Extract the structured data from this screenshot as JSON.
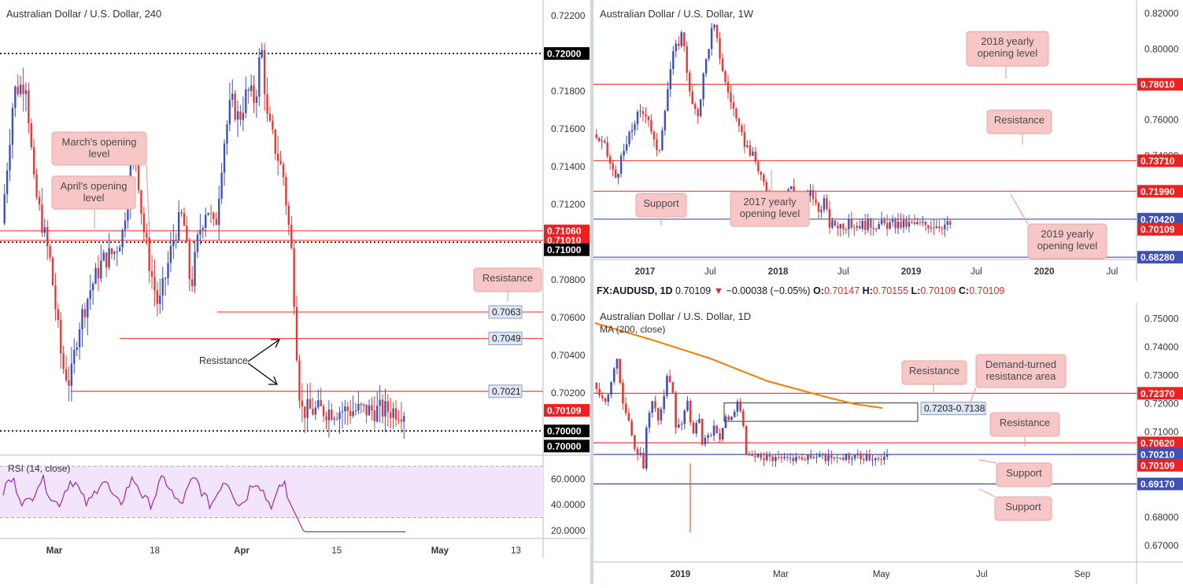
{
  "colors": {
    "up": "#3f51b5",
    "down": "#e53935",
    "hline": "#f04040",
    "blue": "#3f51b5",
    "callout_bg": "#f7c7c7",
    "callout_border": "#e7a5a5",
    "price_tag": "#ef2020",
    "ma": "#f57c00",
    "rsi": "#9c27b0"
  },
  "chart_data": [
    {
      "type": "candlestick",
      "title": "Australian Dollar / U.S. Dollar, 240",
      "ylim": [
        0.6988,
        0.7225
      ],
      "y_ticks": [
        "0.72200",
        "0.71800",
        "0.71600",
        "0.71400",
        "0.71200",
        "0.70800",
        "0.70600",
        "0.70400",
        "0.70200"
      ],
      "y_tick_values": [
        0.722,
        0.718,
        0.716,
        0.714,
        0.712,
        0.708,
        0.706,
        0.704,
        0.702
      ],
      "x_ticks": [
        "Mar",
        "18",
        "Apr",
        "15",
        "May",
        "13"
      ],
      "x_tick_pos": [
        0.1,
        0.285,
        0.445,
        0.62,
        0.81,
        0.95
      ],
      "price_tags": [
        {
          "text": "0.72000",
          "value": 0.72,
          "style": "black"
        },
        {
          "text": "0.71060",
          "value": 0.7106,
          "style": "red"
        },
        {
          "text": "0.71010",
          "value": 0.7101,
          "style": "red"
        },
        {
          "text": "0.71000",
          "value": 0.7096,
          "style": "black"
        },
        {
          "text": "0.70109",
          "value": 0.70109,
          "style": "red"
        },
        {
          "text": "0.70000",
          "value": 0.7,
          "style": "black"
        },
        {
          "text": "0.70000",
          "value": 0.6992,
          "style": "black"
        }
      ],
      "levels": [
        {
          "value": 0.72,
          "style": "dotted",
          "x0": 0.0
        },
        {
          "value": 0.7106,
          "style": "red",
          "x0": 0.0
        },
        {
          "value": 0.7101,
          "style": "red",
          "x0": 0.0
        },
        {
          "value": 0.71,
          "style": "dotted",
          "x0": 0.0
        },
        {
          "value": 0.7063,
          "style": "red",
          "x0": 0.4
        },
        {
          "value": 0.7049,
          "style": "red",
          "x0": 0.22
        },
        {
          "value": 0.7021,
          "style": "red",
          "x0": 0.13
        },
        {
          "value": 0.7,
          "style": "dotted",
          "x0": 0.0
        }
      ],
      "level_labels": [
        {
          "text": "0.7063",
          "value": 0.7063
        },
        {
          "text": "0.7049",
          "value": 0.7049
        },
        {
          "text": "0.7021",
          "value": 0.7021
        }
      ],
      "annotations": [
        "March's opening level",
        "April's opening level",
        "Resistance",
        "Resistance"
      ],
      "series_path": [
        [
          0,
          0.711
        ],
        [
          0.03,
          0.718
        ],
        [
          0.06,
          0.7185
        ],
        [
          0.08,
          0.713
        ],
        [
          0.1,
          0.711
        ],
        [
          0.12,
          0.709
        ],
        [
          0.15,
          0.7035
        ],
        [
          0.17,
          0.7025
        ],
        [
          0.19,
          0.7055
        ],
        [
          0.22,
          0.7075
        ],
        [
          0.25,
          0.709
        ],
        [
          0.28,
          0.7095
        ],
        [
          0.3,
          0.7105
        ],
        [
          0.33,
          0.7155
        ],
        [
          0.35,
          0.711
        ],
        [
          0.37,
          0.7085
        ],
        [
          0.39,
          0.7065
        ],
        [
          0.41,
          0.7085
        ],
        [
          0.43,
          0.7105
        ],
        [
          0.45,
          0.7115
        ],
        [
          0.47,
          0.7075
        ],
        [
          0.49,
          0.7105
        ],
        [
          0.51,
          0.712
        ],
        [
          0.53,
          0.7105
        ],
        [
          0.55,
          0.715
        ],
        [
          0.57,
          0.7175
        ],
        [
          0.59,
          0.7165
        ],
        [
          0.61,
          0.718
        ],
        [
          0.63,
          0.7175
        ],
        [
          0.645,
          0.7205
        ],
        [
          0.66,
          0.7165
        ],
        [
          0.68,
          0.715
        ],
        [
          0.7,
          0.7135
        ],
        [
          0.72,
          0.7095
        ],
        [
          0.73,
          0.706
        ],
        [
          0.735,
          0.7035
        ],
        [
          0.74,
          0.7021
        ],
        [
          0.745,
          0.70109
        ]
      ],
      "rsi": {
        "label": "RSI (14, close)",
        "ylim": [
          15,
          75
        ],
        "ticks": [
          "60.0000",
          "40.0000",
          "20.0000"
        ],
        "tick_values": [
          60,
          40,
          20
        ],
        "band": [
          30,
          70
        ]
      }
    },
    {
      "type": "candlestick",
      "title": "Australian Dollar / U.S. Dollar, 1W",
      "ylim": [
        0.6705,
        0.824
      ],
      "y_ticks": [
        "0.82000",
        "0.80000",
        "0.76000",
        "0.74000",
        "0.70000"
      ],
      "y_tick_values": [
        0.82,
        0.8,
        0.76,
        0.74,
        0.7
      ],
      "x_ticks": [
        "2017",
        "Jul",
        "2018",
        "Jul",
        "2019",
        "Jul",
        "2020",
        "Jul"
      ],
      "x_tick_pos": [
        0.095,
        0.215,
        0.34,
        0.46,
        0.585,
        0.705,
        0.83,
        0.955
      ],
      "price_tags": [
        {
          "text": "0.78010",
          "value": 0.7801,
          "style": "red"
        },
        {
          "text": "0.73710",
          "value": 0.7371,
          "style": "red"
        },
        {
          "text": "0.71990",
          "value": 0.7199,
          "style": "red"
        },
        {
          "text": "0.70420",
          "value": 0.7042,
          "style": "blue"
        },
        {
          "text": "0.70109",
          "value": 0.6985,
          "style": "red"
        },
        {
          "text": "0.68280",
          "value": 0.6828,
          "style": "blue"
        }
      ],
      "levels": [
        {
          "value": 0.7801,
          "style": "red"
        },
        {
          "value": 0.7371,
          "style": "red"
        },
        {
          "value": 0.7199,
          "style": "red"
        },
        {
          "value": 0.7042,
          "style": "blue"
        },
        {
          "value": 0.6828,
          "style": "blue"
        }
      ],
      "annotations": [
        "2018 yearly opening level",
        "Resistance",
        "2017 yearly opening level",
        "Support",
        "2019 yearly opening level"
      ],
      "series_path": [
        [
          0,
          0.752
        ],
        [
          0.03,
          0.745
        ],
        [
          0.06,
          0.727
        ],
        [
          0.09,
          0.745
        ],
        [
          0.12,
          0.762
        ],
        [
          0.15,
          0.765
        ],
        [
          0.18,
          0.738
        ],
        [
          0.2,
          0.768
        ],
        [
          0.22,
          0.795
        ],
        [
          0.25,
          0.81
        ],
        [
          0.27,
          0.773
        ],
        [
          0.29,
          0.76
        ],
        [
          0.31,
          0.788
        ],
        [
          0.335,
          0.815
        ],
        [
          0.35,
          0.8
        ],
        [
          0.37,
          0.78
        ],
        [
          0.39,
          0.768
        ],
        [
          0.41,
          0.752
        ],
        [
          0.43,
          0.745
        ],
        [
          0.45,
          0.738
        ],
        [
          0.47,
          0.728
        ],
        [
          0.49,
          0.712
        ],
        [
          0.51,
          0.72
        ],
        [
          0.53,
          0.706
        ],
        [
          0.55,
          0.725
        ],
        [
          0.57,
          0.708
        ],
        [
          0.59,
          0.712
        ],
        [
          0.61,
          0.72
        ],
        [
          0.63,
          0.708
        ],
        [
          0.645,
          0.716
        ],
        [
          0.66,
          0.7011
        ]
      ]
    },
    {
      "type": "candlestick",
      "title": "Australian Dollar / U.S. Dollar, 1D",
      "ma_label": "MA (200, close)",
      "ylim": [
        0.6655,
        0.7535
      ],
      "y_ticks": [
        "0.75000",
        "0.74000",
        "0.73000",
        "0.72000",
        "0.71000",
        "0.68000",
        "0.67000"
      ],
      "y_tick_values": [
        0.75,
        0.74,
        0.73,
        0.72,
        0.71,
        0.68,
        0.67
      ],
      "x_ticks": [
        "2019",
        "Mar",
        "May",
        "Jul",
        "Sep"
      ],
      "x_tick_pos": [
        0.16,
        0.345,
        0.53,
        0.715,
        0.9
      ],
      "price_tags": [
        {
          "text": "0.72370",
          "value": 0.7237,
          "style": "red"
        },
        {
          "text": "0.70620",
          "value": 0.7062,
          "style": "red"
        },
        {
          "text": "0.70210",
          "value": 0.7021,
          "style": "blue"
        },
        {
          "text": "0.70109",
          "value": 0.6983,
          "style": "red"
        },
        {
          "text": "0.69170",
          "value": 0.6917,
          "style": "blue"
        }
      ],
      "levels": [
        {
          "value": 0.7237,
          "style": "red"
        },
        {
          "value": 0.7062,
          "style": "red"
        },
        {
          "value": 0.7021,
          "style": "blue"
        },
        {
          "value": 0.6917,
          "style": "blue"
        }
      ],
      "zone": {
        "label": "0.7203-0.7138",
        "top": 0.7203,
        "bottom": 0.7138
      },
      "annotations": [
        "Resistance",
        "Demand-turned resistance area",
        "Resistance",
        "Support",
        "Support"
      ],
      "series_path": [
        [
          0,
          0.7275
        ],
        [
          0.02,
          0.724
        ],
        [
          0.04,
          0.7205
        ],
        [
          0.06,
          0.7285
        ],
        [
          0.08,
          0.736
        ],
        [
          0.1,
          0.72
        ],
        [
          0.12,
          0.713
        ],
        [
          0.14,
          0.7035
        ],
        [
          0.16,
          0.703
        ],
        [
          0.17,
          0.6985
        ],
        [
          0.18,
          0.712
        ],
        [
          0.2,
          0.72
        ],
        [
          0.22,
          0.715
        ],
        [
          0.24,
          0.722
        ],
        [
          0.25,
          0.729
        ],
        [
          0.27,
          0.724
        ],
        [
          0.28,
          0.7105
        ],
        [
          0.3,
          0.714
        ],
        [
          0.32,
          0.72
        ],
        [
          0.34,
          0.7095
        ],
        [
          0.36,
          0.715
        ],
        [
          0.37,
          0.7055
        ],
        [
          0.39,
          0.709
        ],
        [
          0.41,
          0.711
        ],
        [
          0.43,
          0.708
        ],
        [
          0.45,
          0.7145
        ],
        [
          0.47,
          0.714
        ],
        [
          0.49,
          0.7195
        ],
        [
          0.5,
          0.718
        ],
        [
          0.51,
          0.7131
        ],
        [
          0.52,
          0.7011
        ]
      ],
      "ma_path": [
        [
          0,
          0.7485
        ],
        [
          0.1,
          0.7425
        ],
        [
          0.2,
          0.736
        ],
        [
          0.3,
          0.728
        ],
        [
          0.4,
          0.7225
        ],
        [
          0.45,
          0.72
        ],
        [
          0.5,
          0.7185
        ]
      ]
    }
  ],
  "symbol_bar": {
    "symbol": "FX:AUDUSD, 1D",
    "price": "0.70109",
    "arrow": "▼",
    "change": "−0.00038 (−0.05%)",
    "o_label": "O:",
    "o_value": "0.70147",
    "h_label": "H:",
    "h_value": "0.70155",
    "l_label": "L:",
    "l_value": "0.70109",
    "c_label": "C:",
    "c_value": "0.70109"
  }
}
